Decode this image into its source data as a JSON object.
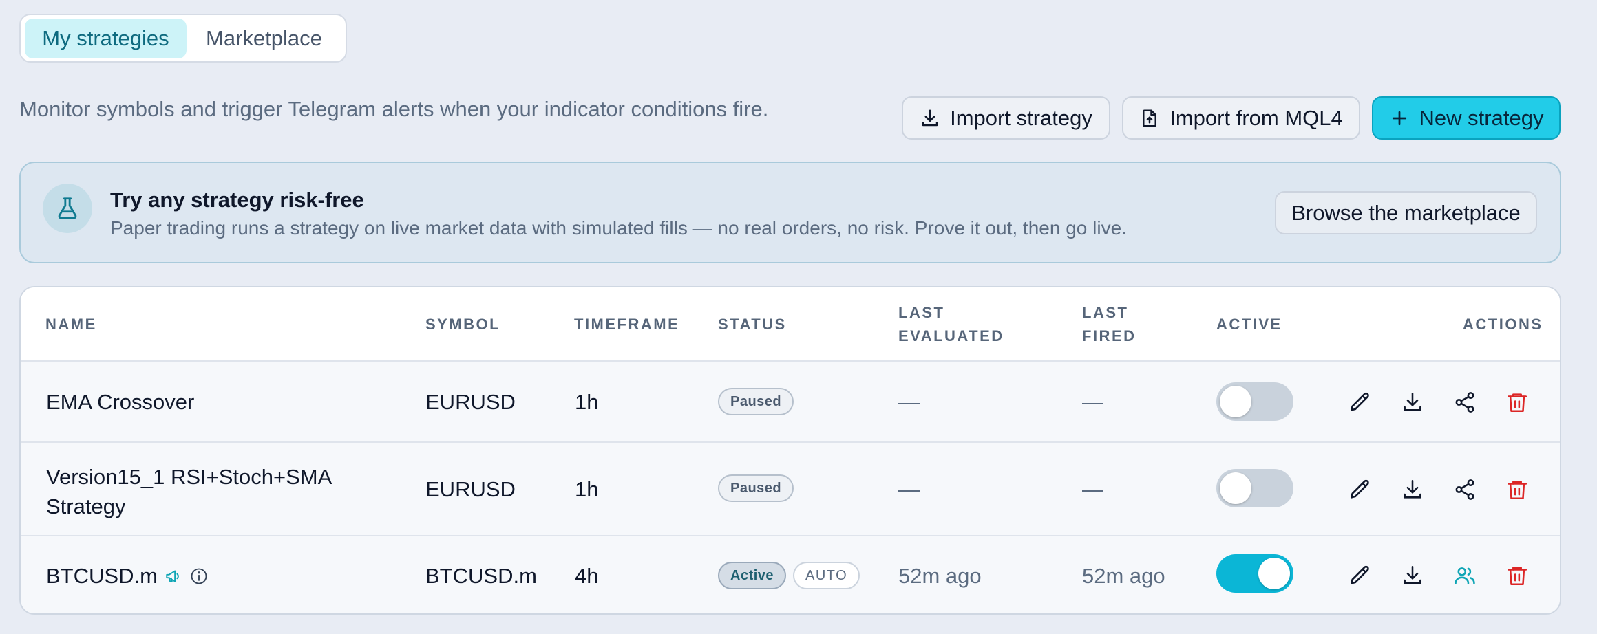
{
  "tabs": {
    "my_strategies": "My strategies",
    "marketplace": "Marketplace"
  },
  "description": "Monitor symbols and trigger Telegram alerts when your indicator conditions fire.",
  "toolbar": {
    "import_strategy": "Import strategy",
    "import_mql4": "Import from MQL4",
    "new_strategy": "New strategy"
  },
  "banner": {
    "title": "Try any strategy risk-free",
    "text": "Paper trading runs a strategy on live market data with simulated fills — no real orders, no risk. Prove it out, then go live.",
    "button": "Browse the marketplace"
  },
  "table": {
    "headers": {
      "name": "NAME",
      "symbol": "SYMBOL",
      "timeframe": "TIMEFRAME",
      "status": "STATUS",
      "last_evaluated_1": "LAST",
      "last_evaluated_2": "EVALUATED",
      "last_fired_1": "LAST",
      "last_fired_2": "FIRED",
      "active": "ACTIVE",
      "actions": "ACTIONS"
    },
    "rows": [
      {
        "name": "EMA Crossover",
        "symbol": "EURUSD",
        "timeframe": "1h",
        "status": "Paused",
        "last_evaluated": "—",
        "last_fired": "—",
        "active": false
      },
      {
        "name_line1": "Version15_1 RSI+Stoch+SMA",
        "name_line2": "Strategy",
        "symbol": "EURUSD",
        "timeframe": "1h",
        "status": "Paused",
        "last_evaluated": "—",
        "last_fired": "—",
        "active": false
      },
      {
        "name": "BTCUSD.m",
        "symbol": "BTCUSD.m",
        "timeframe": "4h",
        "status": "Active",
        "mode": "AUTO",
        "last_evaluated": "52m ago",
        "last_fired": "52m ago",
        "active": true
      }
    ]
  },
  "icons": {
    "download": "download-icon",
    "file_upload": "file-upload-icon",
    "plus": "plus-icon",
    "flask": "flask-icon",
    "edit": "pencil-icon",
    "share": "share-icon",
    "users": "users-icon",
    "delete": "trash-icon",
    "megaphone": "megaphone-icon",
    "info": "info-icon"
  },
  "colors": {
    "accent": "#22cce8",
    "toggle_on": "#0bb6d6",
    "danger": "#dc2626",
    "shared": "#0ea5b5"
  }
}
